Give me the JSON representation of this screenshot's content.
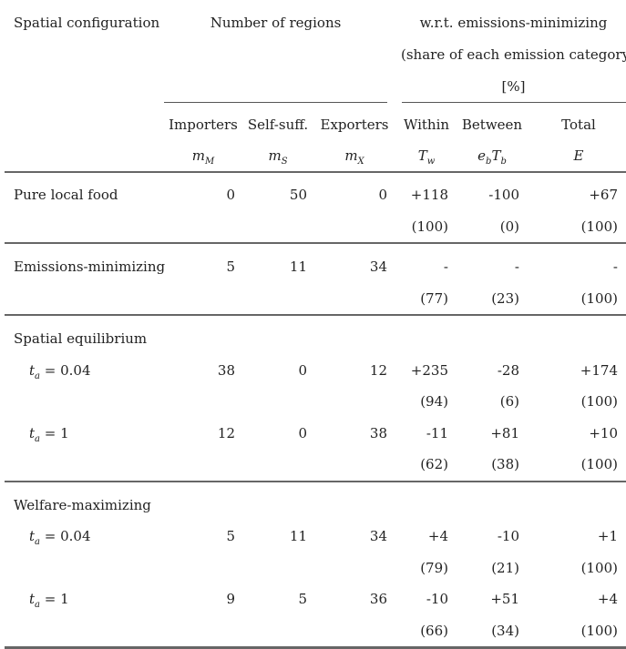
{
  "header": {
    "col0": "Spatial configuration",
    "group_regions": "Number of regions",
    "group_emissions_line1": "w.r.t. emissions-minimizing",
    "group_emissions_line2": "(share of each emission category)",
    "group_emissions_line3": "[%]",
    "columns": [
      {
        "label": "Importers",
        "sym": "m",
        "sub": "M"
      },
      {
        "label": "Self-suff.",
        "sym": "m",
        "sub": "S"
      },
      {
        "label": "Exporters",
        "sym": "m",
        "sub": "X"
      },
      {
        "label": "Within",
        "sym": "T",
        "sub": "w"
      },
      {
        "label": "Between",
        "sym": "e",
        "sub": "b",
        "sym2": "T",
        "sub2": "b"
      },
      {
        "label": "Total",
        "sym": "E",
        "sub": ""
      }
    ]
  },
  "sections": [
    {
      "title": "Pure local food",
      "rows": [
        {
          "label": "",
          "values": [
            "0",
            "50",
            "0",
            "+118",
            "-100",
            "+67"
          ],
          "shares": [
            "(100)",
            "(0)",
            "(100)"
          ]
        }
      ]
    },
    {
      "title": "Emissions-minimizing",
      "rows": [
        {
          "label": "",
          "values": [
            "5",
            "11",
            "34",
            "-",
            "-",
            "-"
          ],
          "shares": [
            "(77)",
            "(23)",
            "(100)"
          ]
        }
      ]
    },
    {
      "title": "Spatial equilibrium",
      "rows": [
        {
          "label_var": "t",
          "label_sub": "a",
          "label_eq": "= 0.04",
          "values": [
            "38",
            "0",
            "12",
            "+235",
            "-28",
            "+174"
          ],
          "shares": [
            "(94)",
            "(6)",
            "(100)"
          ]
        },
        {
          "label_var": "t",
          "label_sub": "a",
          "label_eq": "= 1",
          "values": [
            "12",
            "0",
            "38",
            "-11",
            "+81",
            "+10"
          ],
          "shares": [
            "(62)",
            "(38)",
            "(100)"
          ]
        }
      ]
    },
    {
      "title": "Welfare-maximizing",
      "rows": [
        {
          "label_var": "t",
          "label_sub": "a",
          "label_eq": "= 0.04",
          "values": [
            "5",
            "11",
            "34",
            "+4",
            "-10",
            "+1"
          ],
          "shares": [
            "(79)",
            "(21)",
            "(100)"
          ]
        },
        {
          "label_var": "t",
          "label_sub": "a",
          "label_eq": "= 1",
          "values": [
            "9",
            "5",
            "36",
            "-10",
            "+51",
            "+4"
          ],
          "shares": [
            "(66)",
            "(34)",
            "(100)"
          ]
        }
      ]
    }
  ]
}
